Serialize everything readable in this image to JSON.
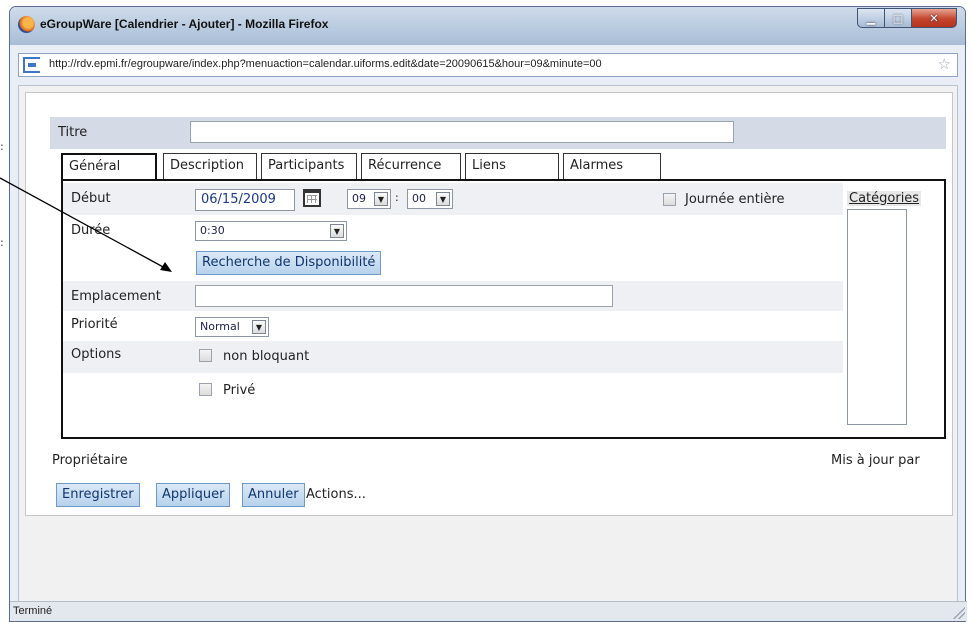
{
  "window": {
    "title": "eGroupWare [Calendrier - Ajouter] - Mozilla Firefox",
    "controls": [
      "minimize",
      "maximize",
      "close"
    ]
  },
  "address_bar": {
    "url": "http://rdv.epmi.fr/egroupware/index.php?menuaction=calendar.uiforms.edit&date=20090615&hour=09&minute=00"
  },
  "form": {
    "titre_label": "Titre",
    "titre_value": "",
    "tabs": [
      {
        "label": "Général",
        "active": true
      },
      {
        "label": "Description",
        "active": false
      },
      {
        "label": "Participants",
        "active": false
      },
      {
        "label": "Récurrence",
        "active": false
      },
      {
        "label": "Liens",
        "active": false
      },
      {
        "label": "Alarmes",
        "active": false
      }
    ],
    "general": {
      "debut_label": "Début",
      "date_value": "06/15/2009",
      "hour_value": "09",
      "time_sep": ":",
      "minute_value": "00",
      "journee_label": "Journée entière",
      "duree_label": "Durée",
      "duree_value": "0:30",
      "recherche_button": "Recherche de Disponibilité",
      "emplacement_label": "Emplacement",
      "emplacement_value": "",
      "priorite_label": "Priorité",
      "priorite_value": "Normal",
      "options_label": "Options",
      "non_bloquant_label": "non bloquant",
      "prive_label": "Privé",
      "categories_label": "Catégories"
    },
    "proprietaire_label": "Propriétaire",
    "mis_a_jour_label": "Mis à jour par",
    "buttons": {
      "enregistrer": "Enregistrer",
      "appliquer": "Appliquer",
      "annuler": "Annuler",
      "actions": "Actions..."
    }
  },
  "statusbar": {
    "text": "Terminé"
  },
  "colors": {
    "button_bg": "#c9dff2",
    "button_text": "#10356f",
    "titre_bar_bg": "#d4dae6"
  }
}
